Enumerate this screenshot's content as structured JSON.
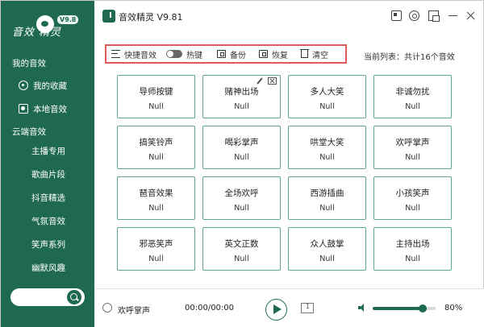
{
  "app": {
    "title": "音效精灵 V9.81",
    "logo_text": "音效 精灵",
    "logo_badge": "V9.8"
  },
  "sidebar": {
    "section_mine": "我的音效",
    "mine_items": [
      {
        "label": "我的收藏",
        "icon": "favorite-icon"
      },
      {
        "label": "本地音效",
        "icon": "local-icon"
      }
    ],
    "section_cloud": "云端音效",
    "cloud_items": [
      "主播专用",
      "歌曲片段",
      "抖音精选",
      "气氛音效",
      "笑声系列",
      "幽默风趣"
    ],
    "search_placeholder": ""
  },
  "toolbar": {
    "quick_sound": "快捷音效",
    "hotkey": "热键",
    "hotkey_enabled": false,
    "backup": "备份",
    "restore": "恢复",
    "clear": "清空"
  },
  "list_info": "当前列表：共计16个音效",
  "sounds": [
    {
      "name": "导师按键",
      "key": "Null"
    },
    {
      "name": "赌神出场",
      "key": "Null"
    },
    {
      "name": "多人大笑",
      "key": "Null"
    },
    {
      "name": "非诚勿扰",
      "key": "Null"
    },
    {
      "name": "搞笑铃声",
      "key": "Null"
    },
    {
      "name": "喝彩掌声",
      "key": "Null"
    },
    {
      "name": "哄堂大笑",
      "key": "Null"
    },
    {
      "name": "欢呼掌声",
      "key": "Null"
    },
    {
      "name": "琶音效果",
      "key": "Null"
    },
    {
      "name": "全场欢呼",
      "key": "Null"
    },
    {
      "name": "西游插曲",
      "key": "Null"
    },
    {
      "name": "小孩笑声",
      "key": "Null"
    },
    {
      "name": "邪恶笑声",
      "key": "Null"
    },
    {
      "name": "英文正数",
      "key": "Null"
    },
    {
      "name": "众人鼓掌",
      "key": "Null"
    },
    {
      "name": "主持出场",
      "key": "Null"
    }
  ],
  "player": {
    "current_track": "欢呼掌声",
    "time": "00:00/00:00",
    "loop_label": "1",
    "volume_percent": 80,
    "volume_label": "80%"
  },
  "colors": {
    "accent": "#1f6a4e",
    "card_border": "#5fa88a",
    "highlight": "#e05a5a"
  }
}
